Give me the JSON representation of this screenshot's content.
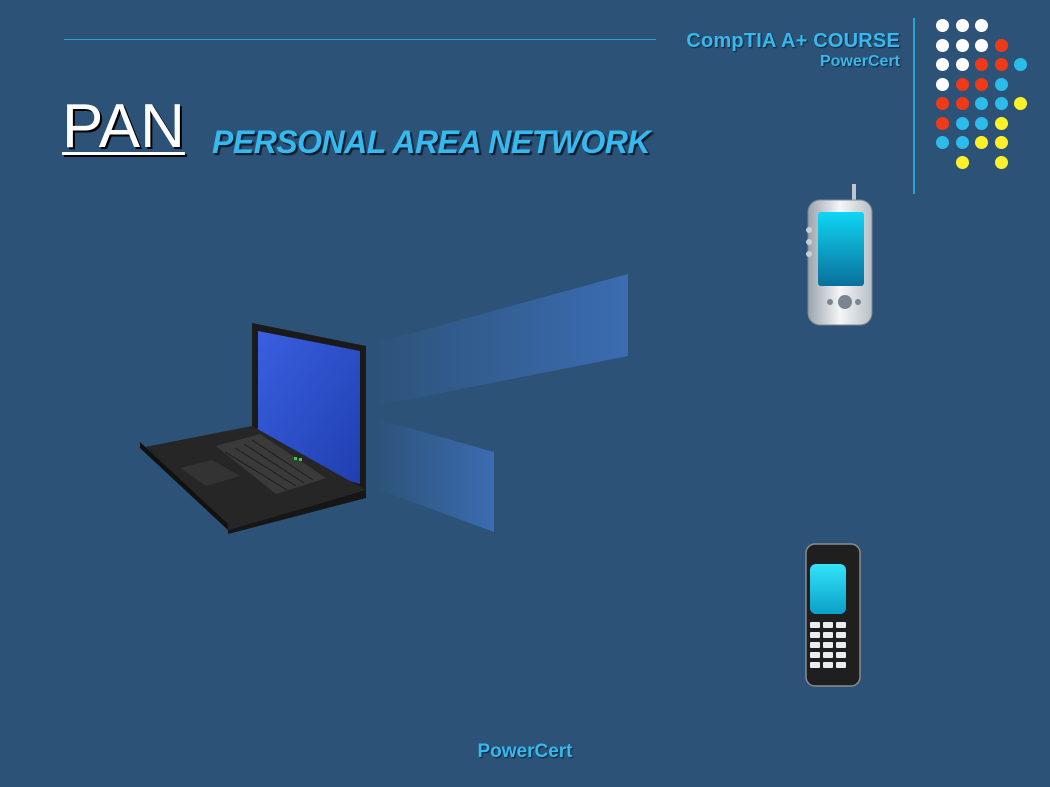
{
  "header": {
    "course_title": "CompTIA A+ COURSE",
    "brand": "PowerCert"
  },
  "title": {
    "abbreviation": "PAN",
    "full_name": "PERSONAL AREA NETWORK"
  },
  "footer": {
    "brand": "PowerCert"
  },
  "decor": {
    "dot_colors": [
      "#ffffff",
      "#f03a17",
      "#2dbbea",
      "#fdf229"
    ]
  }
}
